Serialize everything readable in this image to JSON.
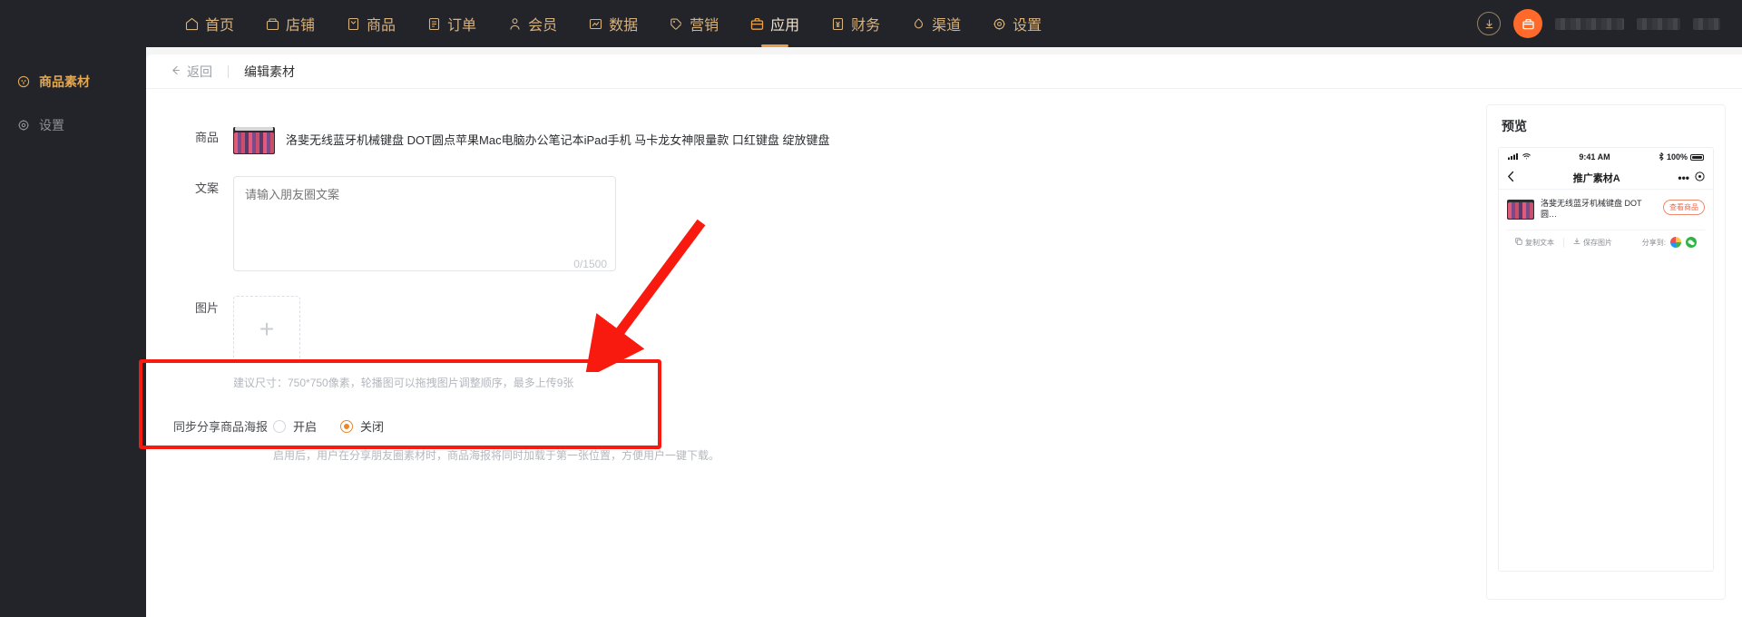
{
  "topnav": {
    "items": [
      {
        "label": "首页",
        "icon": "home-icon",
        "active": false
      },
      {
        "label": "店铺",
        "icon": "store-icon",
        "active": false
      },
      {
        "label": "商品",
        "icon": "goods-icon",
        "active": false
      },
      {
        "label": "订单",
        "icon": "order-icon",
        "active": false
      },
      {
        "label": "会员",
        "icon": "member-icon",
        "active": false
      },
      {
        "label": "数据",
        "icon": "chart-icon",
        "active": false
      },
      {
        "label": "营销",
        "icon": "tag-icon",
        "active": false
      },
      {
        "label": "应用",
        "icon": "apps-icon",
        "active": true
      },
      {
        "label": "财务",
        "icon": "finance-icon",
        "active": false
      },
      {
        "label": "渠道",
        "icon": "channel-icon",
        "active": false
      },
      {
        "label": "设置",
        "icon": "gear-icon",
        "active": false
      }
    ],
    "download_icon": "download-icon",
    "avatar_icon": "shop-avatar-icon"
  },
  "sidebar": {
    "items": [
      {
        "label": "商品素材",
        "icon": "material-icon",
        "active": true
      },
      {
        "label": "设置",
        "icon": "gear-icon",
        "active": false
      }
    ]
  },
  "breadcrumb": {
    "back_label": "返回",
    "back_icon": "arrow-left-icon",
    "current": "编辑素材"
  },
  "form": {
    "product": {
      "label": "商品",
      "title": "洛斐无线蓝牙机械键盘 DOT圆点苹果Mac电脑办公笔记本iPad手机 马卡龙女神限量款 口红键盘 绽放键盘"
    },
    "copy": {
      "label": "文案",
      "placeholder": "请输入朋友圈文案",
      "value": "",
      "counter": "0/1500"
    },
    "images": {
      "label": "图片",
      "add_icon": "plus-icon",
      "hint": "建议尺寸：750*750像素，轮播图可以拖拽图片调整顺序，最多上传9张"
    },
    "sync_poster": {
      "label": "同步分享商品海报",
      "options": [
        {
          "label": "开启",
          "selected": false
        },
        {
          "label": "关闭",
          "selected": true
        }
      ],
      "description": "启用后，用户在分享朋友圈素材时，商品海报将同时加载于第一张位置，方便用户一键下载。"
    }
  },
  "preview": {
    "title": "预览",
    "status_bar": {
      "time": "9:41 AM",
      "battery": "100%",
      "signal_icon": "signal-icon",
      "wifi_icon": "wifi-icon",
      "bluetooth_icon": "bluetooth-icon"
    },
    "nav": {
      "back_icon": "chevron-left-icon",
      "title": "推广素材A",
      "more_icon": "ellipsis-icon",
      "target_icon": "target-icon"
    },
    "card": {
      "product_title": "洛斐无线蓝牙机械键盘 DOT圆…",
      "view_button": "查看商品"
    },
    "actions": [
      {
        "label": "复制文本",
        "icon": "copy-icon"
      },
      {
        "label": "保存图片",
        "icon": "save-image-icon"
      }
    ],
    "share_label": "分享到:",
    "share_icons": [
      "qq-icon",
      "wechat-icon"
    ]
  },
  "annotation": {
    "arrow_icon": "red-arrow-icon",
    "highlight_color": "#f91a0f"
  }
}
